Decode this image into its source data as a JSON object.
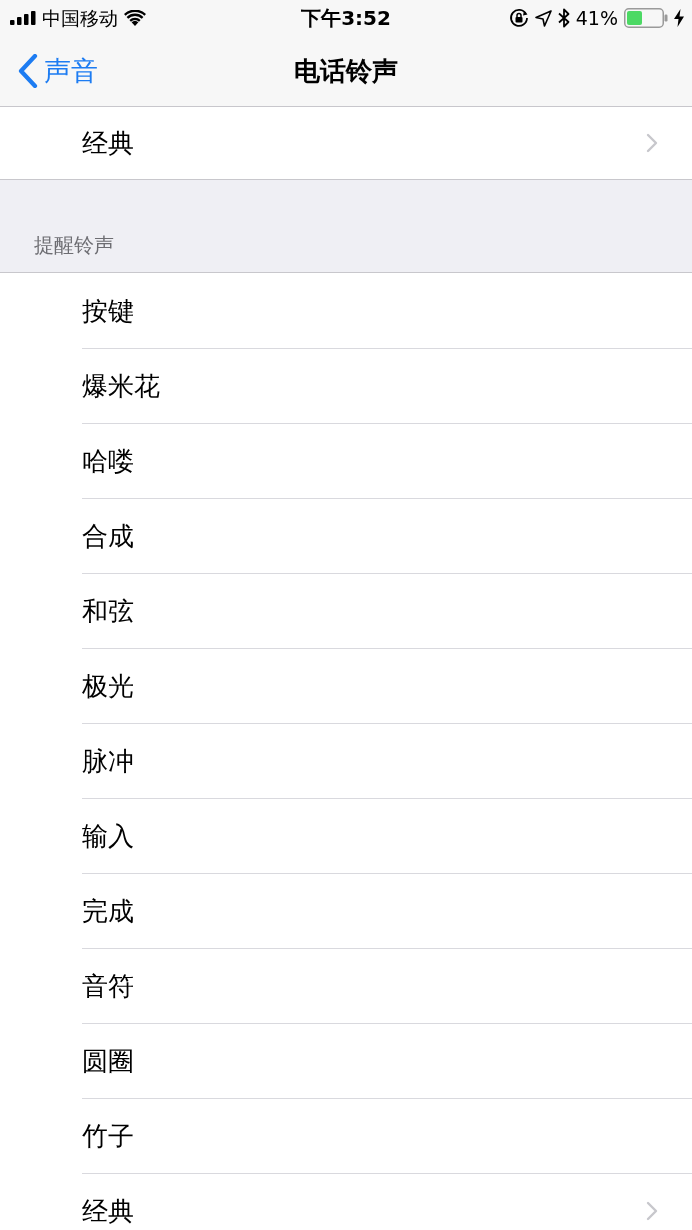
{
  "status_bar": {
    "carrier": "中国移动",
    "time": "下午3:52",
    "battery_percent": "41%"
  },
  "nav_bar": {
    "back_label": "声音",
    "title": "电话铃声"
  },
  "ringtone_section": {
    "items": [
      {
        "label": "经典",
        "kind": "disclosure"
      }
    ]
  },
  "alert_section": {
    "header": "提醒铃声",
    "items": [
      {
        "label": "按键",
        "kind": "plain"
      },
      {
        "label": "爆米花",
        "kind": "plain"
      },
      {
        "label": "哈喽",
        "kind": "plain"
      },
      {
        "label": "合成",
        "kind": "plain"
      },
      {
        "label": "和弦",
        "kind": "plain"
      },
      {
        "label": "极光",
        "kind": "plain"
      },
      {
        "label": "脉冲",
        "kind": "plain"
      },
      {
        "label": "输入",
        "kind": "plain"
      },
      {
        "label": "完成",
        "kind": "plain"
      },
      {
        "label": "音符",
        "kind": "plain"
      },
      {
        "label": "圆圈",
        "kind": "plain"
      },
      {
        "label": "竹子",
        "kind": "plain"
      },
      {
        "label": "经典",
        "kind": "disclosure"
      }
    ]
  }
}
